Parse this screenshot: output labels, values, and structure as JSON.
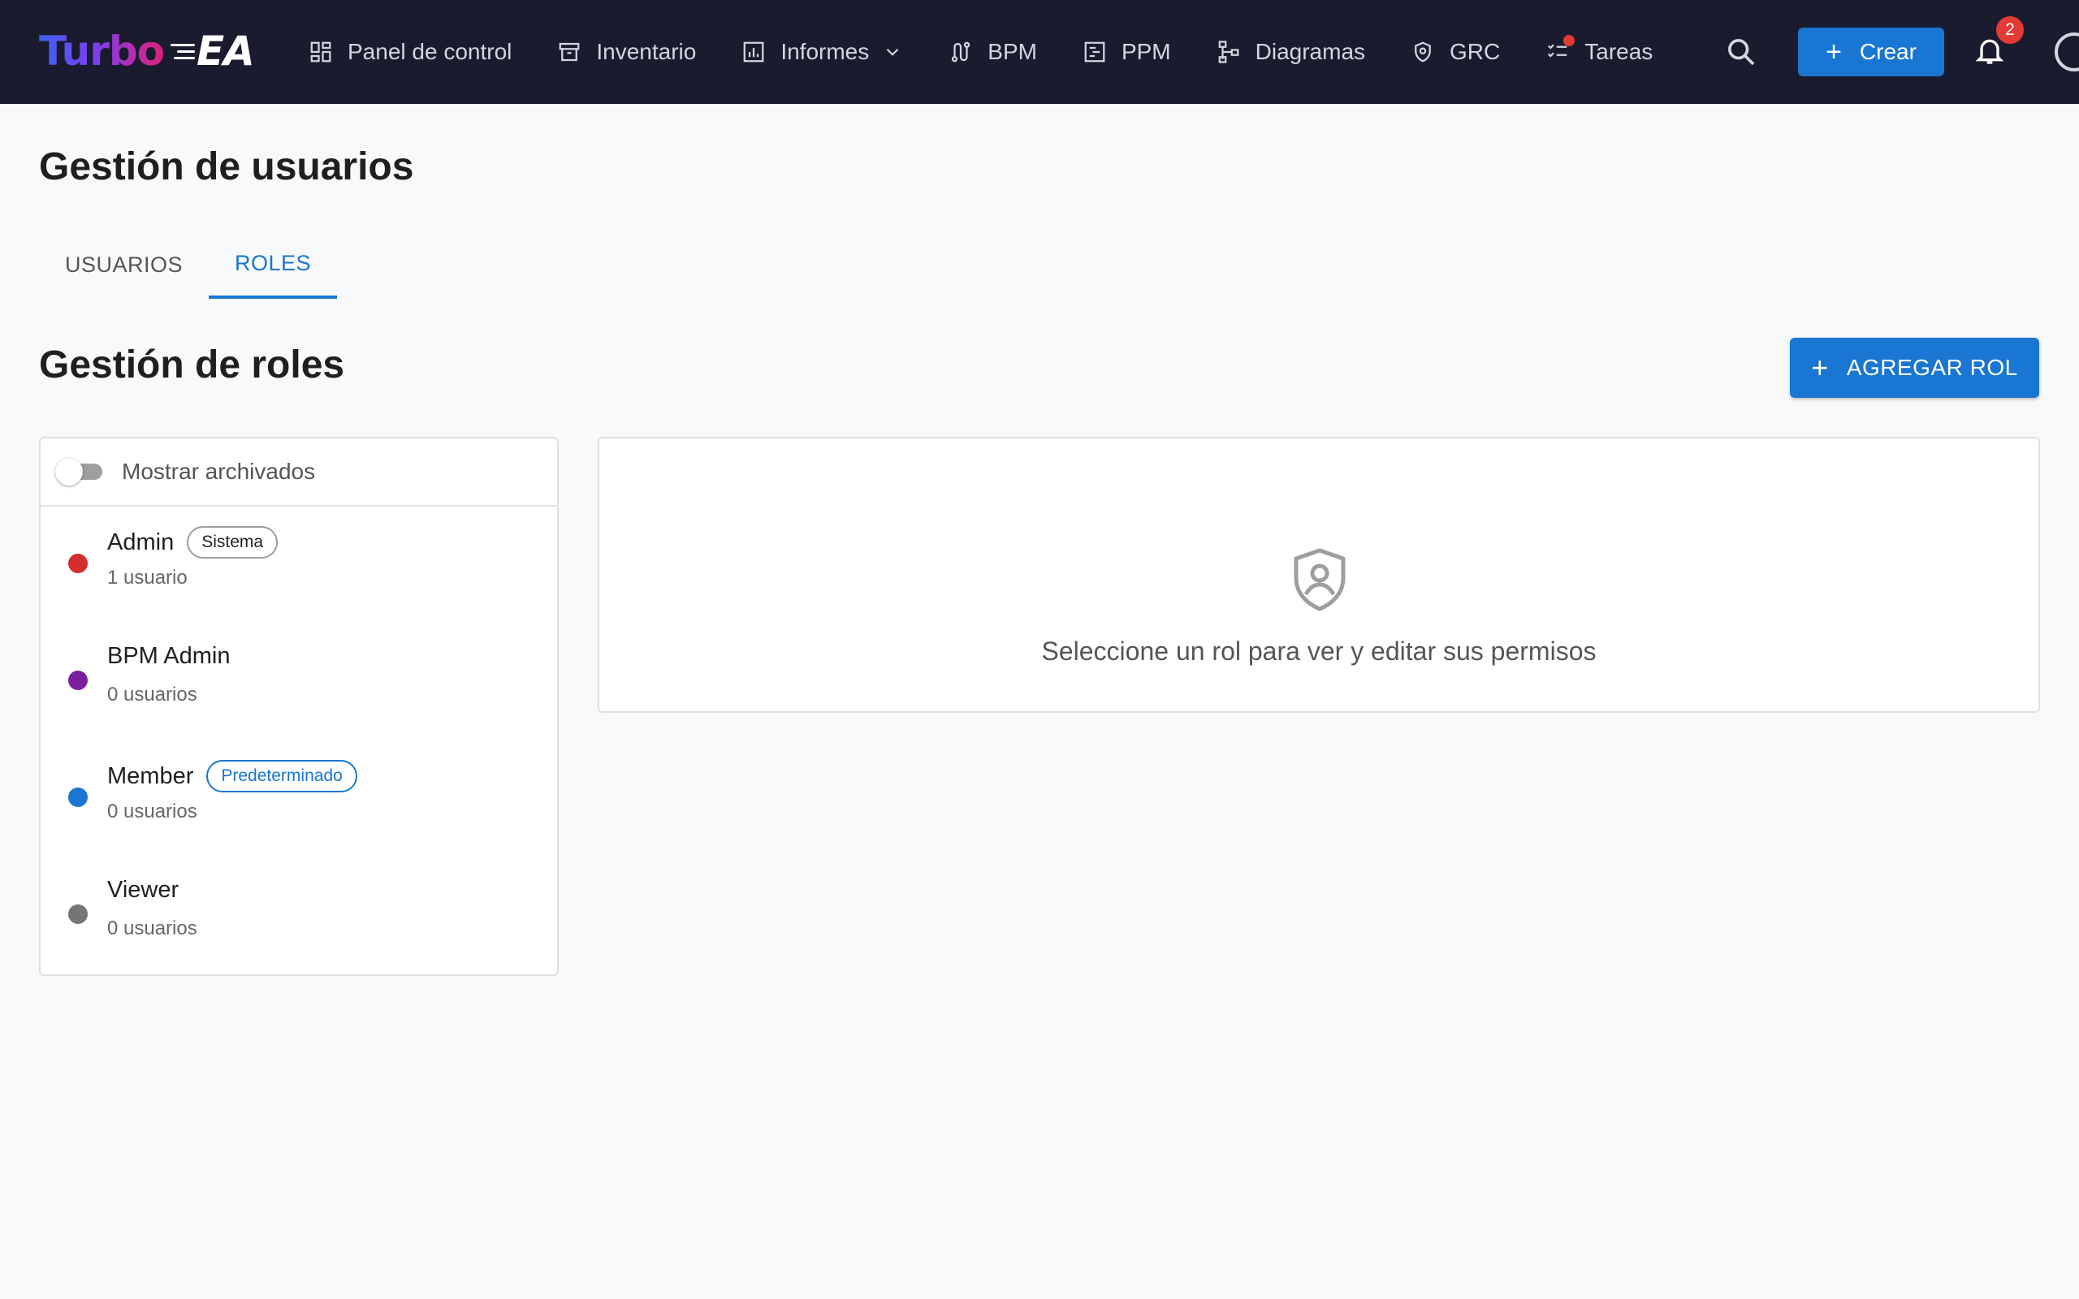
{
  "app": {
    "logo_main": "Turbo",
    "logo_suffix": "EA"
  },
  "nav": {
    "items": [
      {
        "label": "Panel de control",
        "icon": "dashboard-icon"
      },
      {
        "label": "Inventario",
        "icon": "archive-icon"
      },
      {
        "label": "Informes",
        "icon": "bar-chart-icon",
        "has_dropdown": true
      },
      {
        "label": "BPM",
        "icon": "route-icon"
      },
      {
        "label": "PPM",
        "icon": "gantt-icon"
      },
      {
        "label": "Diagramas",
        "icon": "diagram-icon"
      },
      {
        "label": "GRC",
        "icon": "shield-icon"
      },
      {
        "label": "Tareas",
        "icon": "checklist-icon",
        "has_alert_dot": true
      }
    ],
    "create_label": "Crear",
    "notification_count": "2"
  },
  "page": {
    "title": "Gestión de usuarios",
    "tabs": [
      {
        "label": "USUARIOS",
        "active": false
      },
      {
        "label": "ROLES",
        "active": true
      }
    ]
  },
  "roles": {
    "section_title": "Gestión de roles",
    "add_button_label": "AGREGAR ROL",
    "show_archived_label": "Mostrar archivados",
    "show_archived": false,
    "items": [
      {
        "name": "Admin",
        "chip": "Sistema",
        "count": "1 usuario",
        "color": "#d32f2f"
      },
      {
        "name": "BPM Admin",
        "chip": "",
        "count": "0 usuarios",
        "color": "#7b1fa2"
      },
      {
        "name": "Member",
        "chip": "Predeterminado",
        "count": "0 usuarios",
        "color": "#1976d2"
      },
      {
        "name": "Viewer",
        "chip": "",
        "count": "0 usuarios",
        "color": "#757575"
      }
    ],
    "empty_message": "Seleccione un rol para ver y editar sus permisos"
  },
  "colors": {
    "topbar": "#1a1b2e",
    "accent": "#1976d2",
    "badge": "#e53935"
  }
}
